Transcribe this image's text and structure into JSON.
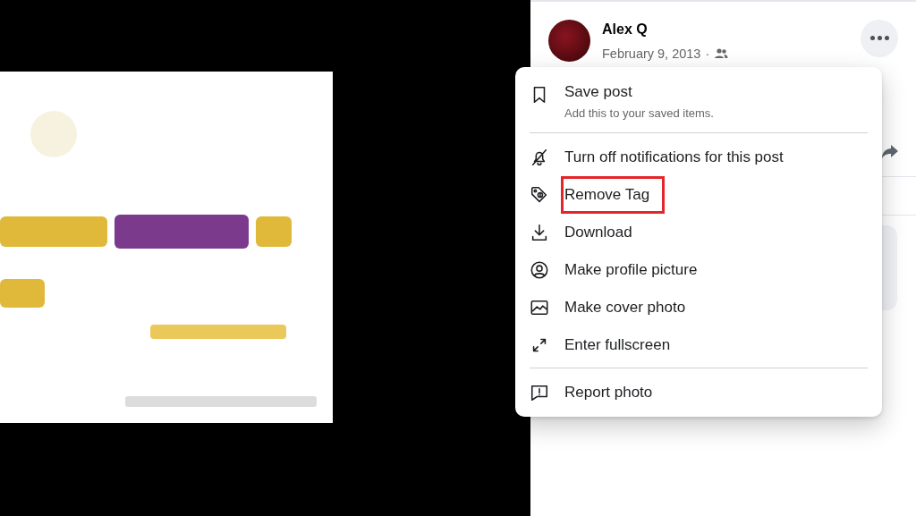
{
  "post": {
    "author": "Alex Q",
    "date": "February 9, 2013",
    "separator": "·"
  },
  "menu": {
    "sections": [
      [
        {
          "label": "Save post",
          "description": "Add this to your saved items.",
          "highlighted": false
        }
      ],
      [
        {
          "label": "Turn off notifications for this post",
          "highlighted": false
        },
        {
          "label": "Remove Tag",
          "highlighted": true
        },
        {
          "label": "Download",
          "highlighted": false
        },
        {
          "label": "Make profile picture",
          "highlighted": false
        },
        {
          "label": "Make cover photo",
          "highlighted": false
        },
        {
          "label": "Enter fullscreen",
          "highlighted": false
        }
      ],
      [
        {
          "label": "Report photo",
          "highlighted": false
        }
      ]
    ]
  }
}
